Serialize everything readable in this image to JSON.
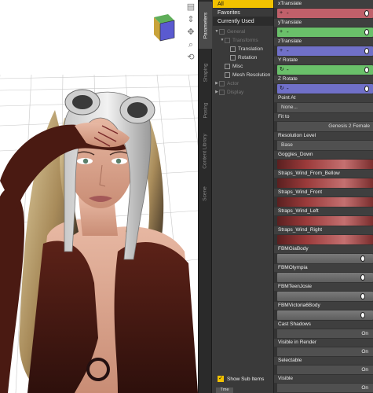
{
  "viewport": {
    "nav_icons": [
      "vertical-arrows-icon",
      "move-cross-icon",
      "zoom-icon",
      "rotate-icon"
    ],
    "view_cube_label": "view cube"
  },
  "side_tabs": [
    "Parameters",
    "Shaping",
    "Posing",
    "Content Library",
    "Scene"
  ],
  "tree": {
    "categories": [
      {
        "label": "All",
        "state": "selected"
      },
      {
        "label": "Favorites",
        "state": "plain"
      },
      {
        "label": "Currently Used",
        "state": "dark"
      }
    ],
    "nodes": [
      {
        "label": "General",
        "indent": 0,
        "arrow": "▼",
        "dim": true
      },
      {
        "label": "Transforms",
        "indent": 1,
        "arrow": "▼",
        "dim": true
      },
      {
        "label": "Translation",
        "indent": 2,
        "arrow": "",
        "dim": false
      },
      {
        "label": "Rotation",
        "indent": 2,
        "arrow": "",
        "dim": false
      },
      {
        "label": "Misc",
        "indent": 1,
        "arrow": "",
        "dim": false
      },
      {
        "label": "Mesh Resolution",
        "indent": 1,
        "arrow": "",
        "dim": false
      },
      {
        "label": "Actor",
        "indent": 0,
        "arrow": "▶",
        "dim": true
      },
      {
        "label": "Display",
        "indent": 0,
        "arrow": "▶",
        "dim": true
      }
    ],
    "show_sub_items": "Show Sub Items",
    "bottom_tab": "Tme"
  },
  "properties": [
    {
      "kind": "slider",
      "label": "xTranslate",
      "color": "#c0606a",
      "knob": 0.97,
      "icon": "+"
    },
    {
      "kind": "slider",
      "label": "yTranslate",
      "color": "#6ac06a",
      "knob": 0.97,
      "icon": "+"
    },
    {
      "kind": "slider",
      "label": "zTranslate",
      "color": "#7070c8",
      "knob": 0.97,
      "icon": "+"
    },
    {
      "kind": "slider",
      "label": "Y Rotate",
      "color": "#6ac06a",
      "knob": 0.97,
      "icon": "↻"
    },
    {
      "kind": "slider",
      "label": "Z Rotate",
      "color": "#7070c8",
      "knob": 0.97,
      "icon": "↻"
    },
    {
      "kind": "field",
      "label": "Point At",
      "value": "None...",
      "align": "left"
    },
    {
      "kind": "field",
      "label": "Fit to",
      "value": "Genesis 2 Female",
      "align": "right"
    },
    {
      "kind": "field",
      "label": "Resolution Level",
      "value": "Base",
      "align": "left"
    },
    {
      "kind": "slider",
      "label": "Goggles_Down",
      "color": "#9a3a3a",
      "knob": -1,
      "icon": "",
      "gradient": true
    },
    {
      "kind": "slider",
      "label": "Straps_Wind_From_Bellow",
      "color": "#9a3a3a",
      "knob": -1,
      "icon": "",
      "gradient": true
    },
    {
      "kind": "slider",
      "label": "Straps_Wind_Front",
      "color": "#9a3a3a",
      "knob": -1,
      "icon": "",
      "gradient": true
    },
    {
      "kind": "slider",
      "label": "Straps_Wind_Left",
      "color": "#9a3a3a",
      "knob": -1,
      "icon": "",
      "gradient": true
    },
    {
      "kind": "slider",
      "label": "Straps_Wind_Right",
      "color": "#9a3a3a",
      "knob": -1,
      "icon": "",
      "gradient": true
    },
    {
      "kind": "slider",
      "label": "FBMGiaBody",
      "color": "#6a6a6a",
      "knob": 0.93,
      "icon": "",
      "grey": true
    },
    {
      "kind": "slider",
      "label": "FBMOlympia",
      "color": "#6a6a6a",
      "knob": 0.93,
      "icon": "",
      "grey": true
    },
    {
      "kind": "slider",
      "label": "FBMTeenJosie",
      "color": "#6a6a6a",
      "knob": 0.93,
      "icon": "",
      "grey": true
    },
    {
      "kind": "slider",
      "label": "FBMVictoria6Body",
      "color": "#6a6a6a",
      "knob": 0.93,
      "icon": "",
      "grey": true
    },
    {
      "kind": "onoff",
      "label": "Cast Shadows",
      "value": "On"
    },
    {
      "kind": "onoff",
      "label": "Visible in Render",
      "value": "On"
    },
    {
      "kind": "onoff",
      "label": "Selectable",
      "value": "On"
    },
    {
      "kind": "onoff",
      "label": "Visible",
      "value": "On"
    }
  ]
}
